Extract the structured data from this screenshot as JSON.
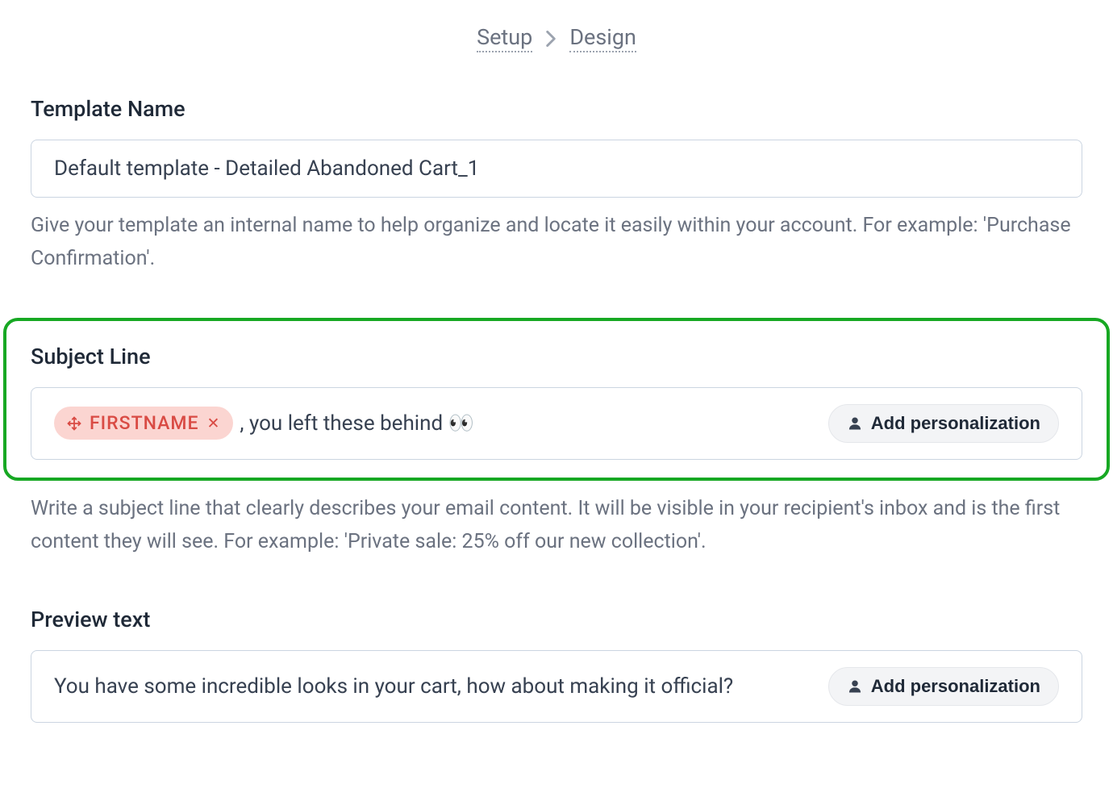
{
  "breadcrumb": {
    "step1": "Setup",
    "step2": "Design"
  },
  "template_name": {
    "label": "Template Name",
    "value": "Default template - Detailed Abandoned Cart_1",
    "help": "Give your template an internal name to help organize and locate it easily within your account. For example: 'Purchase Confirmation'."
  },
  "subject_line": {
    "label": "Subject Line",
    "chip_label": "FIRSTNAME",
    "text": ", you left these behind 👀",
    "add_button": "Add personalization",
    "help": "Write a subject line that clearly describes your email content. It will be visible in your recipient's inbox and is the first content they will see. For example: 'Private sale: 25% off our new collection'."
  },
  "preview_text": {
    "label": "Preview text",
    "value": "You have some incredible looks in your cart, how about making it official?",
    "add_button": "Add personalization"
  },
  "colors": {
    "highlight_border": "#17a823",
    "chip_bg": "#fbd5d1",
    "chip_text": "#d94b44"
  }
}
